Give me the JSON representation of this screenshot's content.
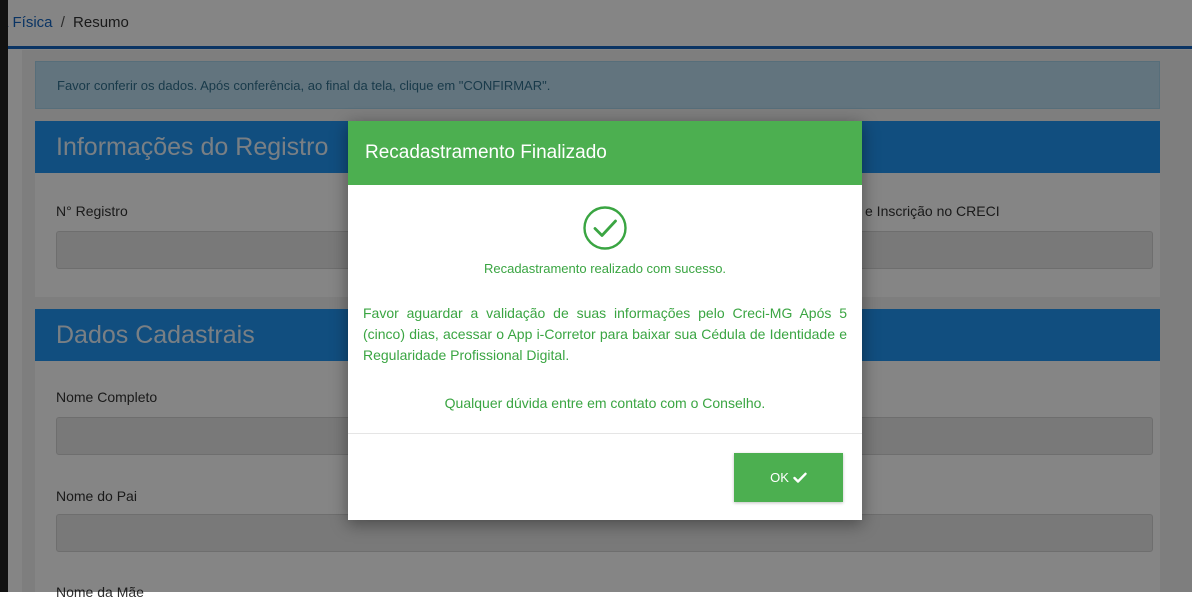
{
  "breadcrumb": {
    "first": "a Física",
    "separator": "/",
    "current": "Resumo"
  },
  "alert": {
    "text": "Favor conferir os dados. Após conferência, ao final da tela, clique em \"CONFIRMAR\"."
  },
  "registro": {
    "title": "Informações do Registro",
    "field1_label": "N° Registro",
    "field2_label": "e Inscrição no CRECI"
  },
  "cadastrais": {
    "title": "Dados Cadastrais",
    "nome_completo_label": "Nome Completo",
    "nome_pai_label": "Nome do Pai",
    "nome_mae_label": "Nome da Mãe"
  },
  "modal": {
    "title": "Recadastramento Finalizado",
    "success": "Recadastramento realizado com sucesso.",
    "info": "Favor aguardar a validação de suas informações pelo Creci-MG Após 5 (cinco) dias, acessar o App i-Corretor para baixar sua Cédula de Identidade e Regularidade Profissional Digital.",
    "contact": "Qualquer dúvida entre em contato com o Conselho.",
    "ok_label": "OK",
    "icon": "check-circle-icon",
    "accent": "#4caf50"
  }
}
